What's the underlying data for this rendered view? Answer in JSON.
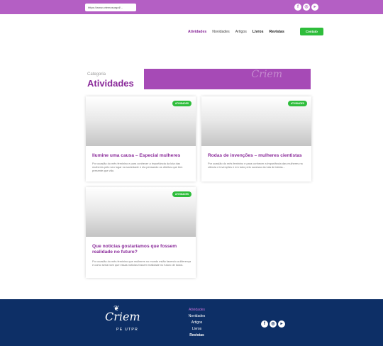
{
  "topbar": {
    "url": "https://www.criemosurgof/...",
    "socials": [
      {
        "icon": "facebook-icon",
        "glyph": "f"
      },
      {
        "icon": "instagram-icon",
        "glyph": "◎"
      },
      {
        "icon": "youtube-icon",
        "glyph": "▸"
      }
    ]
  },
  "nav": {
    "items": [
      "Atividades",
      "Novidades",
      "Artigos",
      "Livros",
      "Revistas"
    ],
    "cta": "Contato"
  },
  "category": {
    "label": "Categoria",
    "title": "Atividades"
  },
  "cards": [
    {
      "badge": "ATIVIDADES",
      "title": "Ilumine uma causa – Especial mulheres",
      "excerpt": "Por ocasião do mês feminino e para conhecer a importância da luta das mulheres pelo seu lugar na sociedade e ela pensando os direitos que tem presente que vão."
    },
    {
      "badge": "ATIVIDADES",
      "title": "Rodas de invenções – mulheres cientistas",
      "excerpt": "Por ocasião do mês feminino e para conhecer a importância das mulheres na ciência e invenções e em tudo pelo sucesso da luta de ideias..."
    },
    {
      "badge": "ATIVIDADES",
      "title": "Que notícias gostaríamos que fossem realidade no futuro?",
      "excerpt": "Por ocasião do mês feminino que mulheres no mundo estão fazendo a diferença e como seria bom que essas notícias fossem realidade no futuro de todos."
    }
  ],
  "footer": {
    "logo": "Criem",
    "logo_sub": "PE UTPR",
    "nav": [
      "Atividades",
      "Novidades",
      "Artigos",
      "Livros",
      "Revistas"
    ],
    "socials": [
      {
        "icon": "facebook-icon",
        "glyph": "f"
      },
      {
        "icon": "instagram-icon",
        "glyph": "◎"
      },
      {
        "icon": "youtube-icon",
        "glyph": "▸"
      }
    ]
  },
  "colors": {
    "brand_purple": "#b45fc4",
    "title_purple": "#8a2a9a",
    "accent_green": "#2ebd3b",
    "footer_navy": "#0d2f66"
  }
}
